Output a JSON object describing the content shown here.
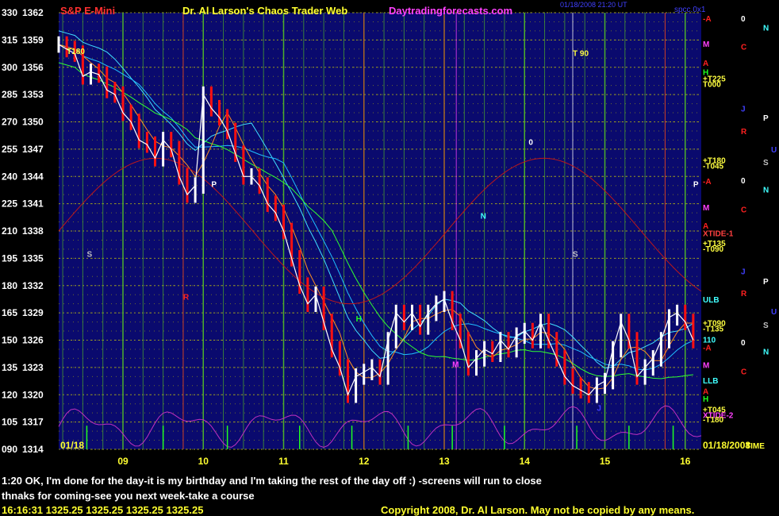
{
  "header": {
    "title_left": "S&P E-Mini",
    "title_center": "Dr. Al Larson's Chaos Trader Web",
    "site": "Daytradingforecasts.com",
    "timestamp": "01/18/2008 21:20 UT",
    "corner_code": "spcc.0x1"
  },
  "chart_data": {
    "type": "line",
    "title": "S&P E-Mini",
    "date_left": "01/18",
    "date_right": "01/18/2008",
    "time_label": "TIME",
    "ylim": [
      1314,
      1362
    ],
    "y_ticks": [
      {
        "count": "330",
        "price": "1362"
      },
      {
        "count": "315",
        "price": "1359"
      },
      {
        "count": "300",
        "price": "1356"
      },
      {
        "count": "285",
        "price": "1353"
      },
      {
        "count": "270",
        "price": "1350"
      },
      {
        "count": "255",
        "price": "1347"
      },
      {
        "count": "240",
        "price": "1344"
      },
      {
        "count": "225",
        "price": "1341"
      },
      {
        "count": "210",
        "price": "1338"
      },
      {
        "count": "195",
        "price": "1335"
      },
      {
        "count": "180",
        "price": "1332"
      },
      {
        "count": "165",
        "price": "1329"
      },
      {
        "count": "150",
        "price": "1326"
      },
      {
        "count": "135",
        "price": "1323"
      },
      {
        "count": "120",
        "price": "1320"
      },
      {
        "count": "105",
        "price": "1317"
      },
      {
        "count": "090",
        "price": "1314"
      }
    ],
    "x_ticks": [
      "09",
      "10",
      "11",
      "12",
      "13",
      "14",
      "15",
      "16"
    ],
    "xlim": [
      8.2,
      16.2
    ],
    "price_series": {
      "name": "S&P E-Mini",
      "x": [
        8.2,
        8.3,
        8.4,
        8.5,
        8.6,
        8.7,
        8.8,
        8.9,
        9.0,
        9.1,
        9.2,
        9.3,
        9.4,
        9.5,
        9.6,
        9.7,
        9.8,
        9.9,
        10.0,
        10.1,
        10.2,
        10.3,
        10.4,
        10.5,
        10.6,
        10.7,
        10.8,
        10.9,
        11.0,
        11.1,
        11.2,
        11.3,
        11.4,
        11.5,
        11.6,
        11.7,
        11.8,
        11.9,
        12.0,
        12.1,
        12.2,
        12.3,
        12.4,
        12.5,
        12.6,
        12.7,
        12.8,
        12.9,
        13.0,
        13.1,
        13.2,
        13.3,
        13.4,
        13.5,
        13.6,
        13.7,
        13.8,
        13.9,
        14.0,
        14.1,
        14.2,
        14.3,
        14.4,
        14.5,
        14.6,
        14.7,
        14.8,
        14.9,
        15.0,
        15.1,
        15.2,
        15.3,
        15.4,
        15.5,
        15.6,
        15.7,
        15.8,
        15.9,
        16.0,
        16.1
      ],
      "values": [
        1358.5,
        1358,
        1357.5,
        1355,
        1355.5,
        1355.2,
        1353.5,
        1353,
        1351,
        1350,
        1348,
        1347.5,
        1346,
        1348,
        1347,
        1344,
        1342,
        1343,
        1353,
        1351.5,
        1350.5,
        1349,
        1346.5,
        1344,
        1344,
        1343,
        1341,
        1340,
        1338,
        1335,
        1332,
        1330,
        1331,
        1328,
        1325,
        1323,
        1320,
        1322,
        1322.5,
        1323,
        1322,
        1326,
        1329,
        1328,
        1329,
        1327.5,
        1329,
        1330,
        1330.5,
        1328,
        1326,
        1323,
        1324,
        1325,
        1324.5,
        1326,
        1325,
        1326.5,
        1327,
        1326,
        1328,
        1326,
        1324,
        1322,
        1321,
        1320.5,
        1320,
        1321,
        1321.5,
        1325,
        1328,
        1326,
        1322,
        1323,
        1324,
        1326,
        1328.5,
        1329,
        1328,
        1326
      ]
    },
    "right_scale_labels": [
      {
        "text": "-A",
        "price": 1361.4,
        "color": "#ff2020"
      },
      {
        "text": "M",
        "price": 1358.6,
        "color": "#ff40ff"
      },
      {
        "text": "A",
        "price": 1356.5,
        "color": "#ff2020"
      },
      {
        "text": "H",
        "price": 1355.5,
        "color": "#20ff20"
      },
      {
        "text": "+T225",
        "price": 1354.8,
        "color": "#ffff40"
      },
      {
        "text": "T000",
        "price": 1354.2,
        "color": "#ffff40"
      },
      {
        "text": "+T180",
        "price": 1345.8,
        "color": "#ffff40"
      },
      {
        "text": "-T045",
        "price": 1345.2,
        "color": "#ffff40"
      },
      {
        "text": "-A",
        "price": 1343.5,
        "color": "#ff2020"
      },
      {
        "text": "M",
        "price": 1340.6,
        "color": "#ff40ff"
      },
      {
        "text": "A",
        "price": 1338.6,
        "color": "#ff2020"
      },
      {
        "text": "XTIDE-1",
        "price": 1337.8,
        "color": "#ff4040"
      },
      {
        "text": "+T135",
        "price": 1336.7,
        "color": "#ffff40"
      },
      {
        "text": "-T090",
        "price": 1336.1,
        "color": "#ffff40"
      },
      {
        "text": "ULB",
        "price": 1330.5,
        "color": "#40ffff"
      },
      {
        "text": "+T090",
        "price": 1327.9,
        "color": "#ffff40"
      },
      {
        "text": "-T135",
        "price": 1327.3,
        "color": "#ffff40"
      },
      {
        "text": "110",
        "price": 1326.1,
        "color": "#40ffff"
      },
      {
        "text": "-A",
        "price": 1325.2,
        "color": "#ff2020"
      },
      {
        "text": "M",
        "price": 1323.3,
        "color": "#ff40ff"
      },
      {
        "text": "LLB",
        "price": 1321.6,
        "color": "#40ffff"
      },
      {
        "text": "A",
        "price": 1320.4,
        "color": "#ff2020"
      },
      {
        "text": "H",
        "price": 1319.6,
        "color": "#20ff20"
      },
      {
        "text": "+T045",
        "price": 1318.4,
        "color": "#ffff40"
      },
      {
        "text": "XTIDE-2",
        "price": 1317.8,
        "color": "#ff40ff"
      },
      {
        "text": "-T180",
        "price": 1317.3,
        "color": "#ffff40"
      }
    ],
    "planet_labels": [
      {
        "text": "0",
        "col": 0,
        "price": 1361.4,
        "color": "#ffffff"
      },
      {
        "text": "N",
        "col": 1,
        "price": 1360.4,
        "color": "#40ffff"
      },
      {
        "text": "C",
        "col": 0,
        "price": 1358.3,
        "color": "#ff2020"
      },
      {
        "text": "J",
        "col": 0,
        "price": 1351.5,
        "color": "#4040ff"
      },
      {
        "text": "P",
        "col": 1,
        "price": 1350.5,
        "color": "#ffffff"
      },
      {
        "text": "R",
        "col": 0,
        "price": 1349.0,
        "color": "#ff2020"
      },
      {
        "text": "U",
        "col": 2,
        "price": 1347.0,
        "color": "#4040ff"
      },
      {
        "text": "S",
        "col": 1,
        "price": 1345.6,
        "color": "#c0c0c0"
      },
      {
        "text": "0",
        "col": 0,
        "price": 1343.6,
        "color": "#ffffff"
      },
      {
        "text": "N",
        "col": 1,
        "price": 1342.6,
        "color": "#40ffff"
      },
      {
        "text": "C",
        "col": 0,
        "price": 1340.4,
        "color": "#ff2020"
      },
      {
        "text": "J",
        "col": 0,
        "price": 1333.6,
        "color": "#4040ff"
      },
      {
        "text": "P",
        "col": 1,
        "price": 1332.5,
        "color": "#ffffff"
      },
      {
        "text": "R",
        "col": 0,
        "price": 1331.2,
        "color": "#ff2020"
      },
      {
        "text": "U",
        "col": 2,
        "price": 1329.2,
        "color": "#4040ff"
      },
      {
        "text": "S",
        "col": 1,
        "price": 1327.7,
        "color": "#c0c0c0"
      },
      {
        "text": "0",
        "col": 0,
        "price": 1325.8,
        "color": "#ffffff"
      },
      {
        "text": "N",
        "col": 1,
        "price": 1324.8,
        "color": "#40ffff"
      },
      {
        "text": "C",
        "col": 0,
        "price": 1322.6,
        "color": "#ff2020"
      }
    ],
    "chart_annotations": [
      {
        "text": "T180",
        "x": 8.3,
        "price": 1357.8,
        "color": "#ffff40"
      },
      {
        "text": "T 90",
        "x": 14.6,
        "price": 1357.6,
        "color": "#ffff40"
      },
      {
        "text": "0",
        "x": 14.05,
        "price": 1347.8,
        "color": "#ffffff"
      },
      {
        "text": "P",
        "x": 10.1,
        "price": 1343.2,
        "color": "#ffffff"
      },
      {
        "text": "P",
        "x": 16.1,
        "price": 1343.2,
        "color": "#ffffff"
      },
      {
        "text": "N",
        "x": 13.45,
        "price": 1339.7,
        "color": "#40ffff"
      },
      {
        "text": "S",
        "x": 8.55,
        "price": 1335.5,
        "color": "#c0c0c0"
      },
      {
        "text": "S",
        "x": 14.6,
        "price": 1335.5,
        "color": "#c0c0c0"
      },
      {
        "text": "R",
        "x": 9.75,
        "price": 1330.8,
        "color": "#ff2020"
      },
      {
        "text": "H",
        "x": 11.9,
        "price": 1328.4,
        "color": "#20ff20"
      },
      {
        "text": "M",
        "x": 13.1,
        "price": 1323.4,
        "color": "#ff40ff"
      },
      {
        "text": "J",
        "x": 14.9,
        "price": 1318.6,
        "color": "#4040ff"
      }
    ]
  },
  "footer": {
    "line1": "1:20 OK, I'm done for the day-it is my birthday and I'm taking the rest of the day off :) -screens will run to close",
    "line2": "thnaks for coming-see you next week-take a course",
    "quote": "16:16:31  1325.25  1325.25  1325.25  1325.25",
    "copyright": "Copyright 2008, Dr. Al Larson. May not be copied by any means."
  },
  "colors": {
    "plot_bg": "#0a0a6e",
    "grid_h": "#a0a020",
    "grid_v": "#4caf2a",
    "price_up": "#ffffff",
    "price_down": "#ff1010",
    "label_left": "#ffffff",
    "title_red": "#ff3030",
    "title_yellow": "#ffff30",
    "site_magenta": "#ff40ff"
  }
}
